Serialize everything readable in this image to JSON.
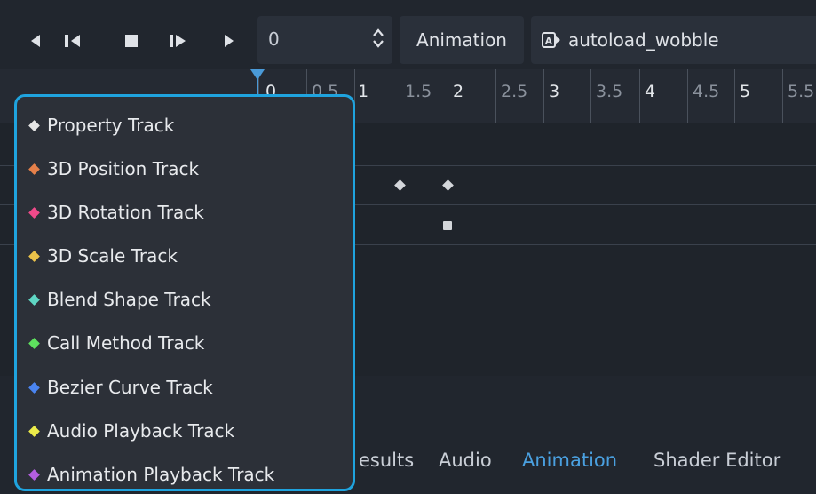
{
  "toolbar": {
    "frame_value": "0",
    "animation_button": "Animation",
    "animation_name": "autoload_wobble"
  },
  "timeline": {
    "ticks": [
      {
        "label": "0",
        "major": true
      },
      {
        "label": "0.5",
        "major": false
      },
      {
        "label": "1",
        "major": true
      },
      {
        "label": "1.5",
        "major": false
      },
      {
        "label": "2",
        "major": true
      },
      {
        "label": "2.5",
        "major": false
      },
      {
        "label": "3",
        "major": true
      },
      {
        "label": "3.5",
        "major": false
      },
      {
        "label": "4",
        "major": true
      },
      {
        "label": "4.5",
        "major": false
      },
      {
        "label": "5",
        "major": true
      },
      {
        "label": "5.5",
        "major": false
      }
    ]
  },
  "bottom_tabs": [
    {
      "label": "esults",
      "active": false
    },
    {
      "label": "Audio",
      "active": false
    },
    {
      "label": "Animation",
      "active": true
    },
    {
      "label": "Shader Editor",
      "active": false
    }
  ],
  "menu": {
    "items": [
      {
        "label": "Property Track",
        "color": "#e6e6e6"
      },
      {
        "label": "3D Position Track",
        "color": "#e5804a"
      },
      {
        "label": "3D Rotation Track",
        "color": "#ef4a8a"
      },
      {
        "label": "3D Scale Track",
        "color": "#eac24a"
      },
      {
        "label": "Blend Shape Track",
        "color": "#5fd6c4"
      },
      {
        "label": "Call Method Track",
        "color": "#5ee05e"
      },
      {
        "label": "Bezier Curve Track",
        "color": "#4a84f0"
      },
      {
        "label": "Audio Playback Track",
        "color": "#ecec4a"
      },
      {
        "label": "Animation Playback Track",
        "color": "#b45ee0"
      }
    ]
  }
}
